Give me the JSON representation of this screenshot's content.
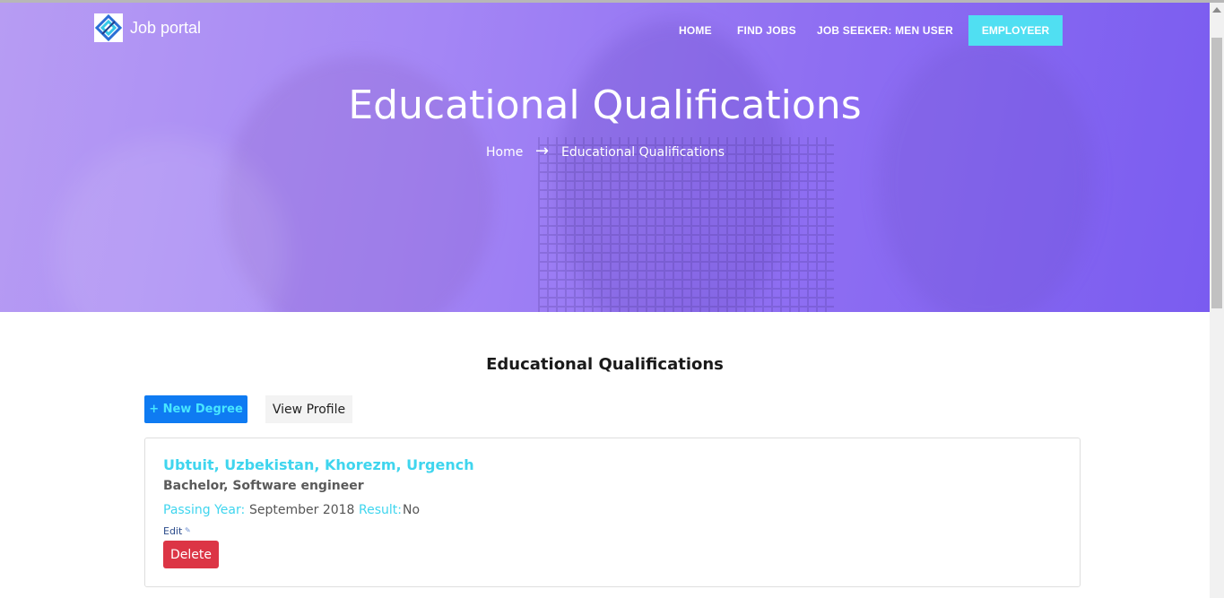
{
  "header": {
    "brand": "Job portal",
    "nav": {
      "home": "HOME",
      "find_jobs": "FIND JOBS",
      "job_seeker": "JOB SEEKER: MEN USER",
      "employer": "EMPLOYEER"
    }
  },
  "hero": {
    "title": "Educational Qualifications",
    "breadcrumb": {
      "home": "Home",
      "current": "Educational Qualifications"
    }
  },
  "main": {
    "section_title": "Educational Qualifications",
    "actions": {
      "new_degree": "+ New Degree",
      "view_profile": "View Profile"
    },
    "qualifications": [
      {
        "institution": "Ubtuit, Uzbekistan, Khorezm, Urgench",
        "degree": "Bachelor, Software engineer",
        "passing_year_label": "Passing Year:",
        "passing_year": "September 2018",
        "result_label": "Result:",
        "result": "No",
        "edit_label": "Edit",
        "delete_label": "Delete"
      }
    ]
  },
  "colors": {
    "accent": "#50dff2",
    "primary_button": "#0f7bf2",
    "danger": "#dc3545",
    "hero_start": "#b79cf3",
    "hero_end": "#7a5cf0"
  },
  "icons": {
    "logo": "job-portal-logo-icon",
    "dropdown": "chevron-down-icon",
    "breadcrumb_separator": "arrow-right-icon",
    "edit": "pencil-icon"
  }
}
